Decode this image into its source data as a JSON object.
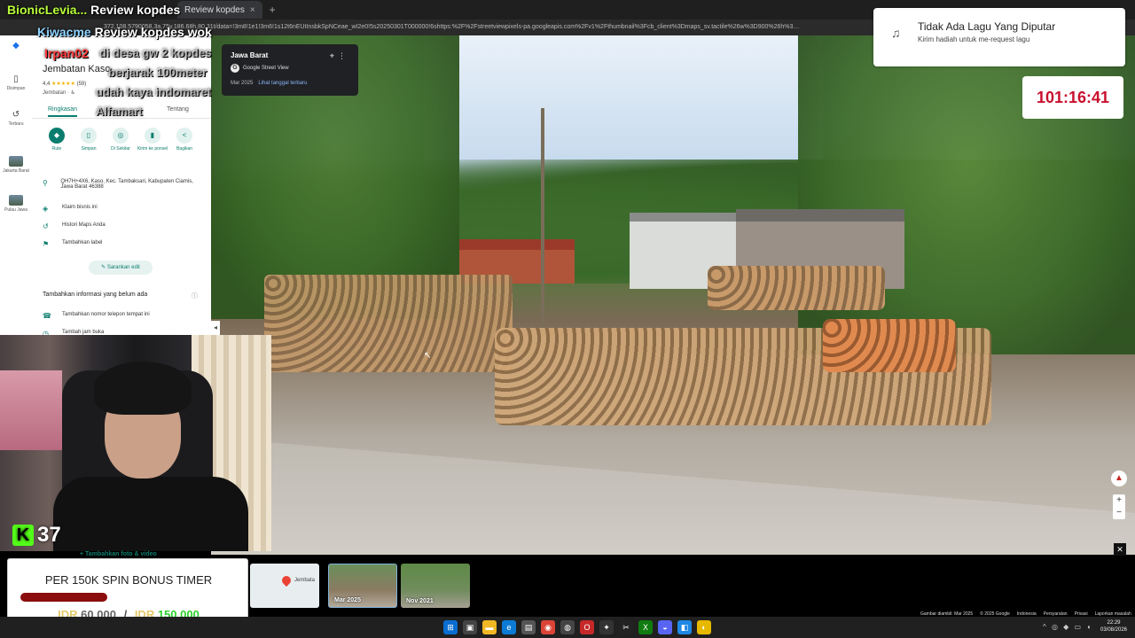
{
  "browser": {
    "tab_title": "Review kopdes",
    "url": "…372,108.5790058,3a,75y,186.68h,80.31t/data=!3m8!1e1!3m6!1s12t6nEUtInsbkSpNCeae_wI2e0!5s20250301T000000!6shttps:%2F%2Fstreetviewpixels-pa.googleapis.com%2Fv1%2Fthumbnail%3Fcb_client%3Dmaps_sv.tactile%26w%3D900%26h%3…"
  },
  "overlay": {
    "alert_user": "BionicLevia...",
    "alert_msg": "Review kopdes",
    "title2_user": "Kiwacme",
    "title2_msg": "Review kopdes wok",
    "irpan_user": "Irpan02",
    "ghost1": "di desa gw 2 kopdes",
    "ghost2": "berjarak 100meter",
    "ghost3": "udah kaya indomaret",
    "ghost4": "Alfamart"
  },
  "panel": {
    "title": "Jembatan Kaso",
    "rating": "4,4",
    "stars": "★★★★★",
    "reviews": "(59)",
    "type": "Jembatan · ♿",
    "tabs": [
      "Ringkasan",
      "Tentang"
    ],
    "actions": [
      {
        "label": "Rute",
        "icon": "◆"
      },
      {
        "label": "Simpan",
        "icon": "▯"
      },
      {
        "label": "Di Sekitar",
        "icon": "◎"
      },
      {
        "label": "Kirim ke ponsel",
        "icon": "▮"
      },
      {
        "label": "Bagikan",
        "icon": "<"
      }
    ],
    "address": "QH7H+4X6, Kaso, Kec. Tambaksari, Kabupaten Ciamis, Jawa Barat 46388",
    "claim": "Klaim bisnis ini",
    "history": "Histori Maps Anda",
    "add_label": "Tambahkan label",
    "suggest": "Saran­kan edit",
    "add_info": "Tambahkan informasi yang belum ada",
    "add_phone": "Tambahkan nomor telepon tempat ini",
    "add_hours": "Tambah jam buka",
    "add_photo": "Tambahkan foto & video"
  },
  "rail": {
    "saved": "Disimpan",
    "recent": "Terbaru",
    "jakarta": "Jakarta Barat",
    "java": "Pulau Jawa"
  },
  "svcard": {
    "region": "Jawa Barat",
    "brand": "Google Street View",
    "date": "Mar 2025",
    "latest_link": "Lihat tanggal terbaru"
  },
  "song": {
    "title": "Tidak Ada Lagu Yang Diputar",
    "subtitle": "Kirim hadiah untuk me-request lagu"
  },
  "timer": "101:16:41",
  "kick": {
    "count": "37"
  },
  "goal": {
    "title": "PER 150K SPIN BONUS TIMER",
    "currency": "IDR",
    "current": "60.000",
    "target": "150.000",
    "progress": 0.4
  },
  "thumbs": {
    "map_label": "Jembata",
    "p1": "Mar 2025",
    "p2": "Nov 2021"
  },
  "credits": {
    "imagery": "Gambar diambil: Mar 2025",
    "copy": "© 2025 Google",
    "lang": "Indonesia",
    "terms": "Persyaratan",
    "privacy": "Privasi",
    "report": "Laporkan masalah"
  },
  "clock": {
    "time": "22:29",
    "date": "03/08/2026"
  }
}
